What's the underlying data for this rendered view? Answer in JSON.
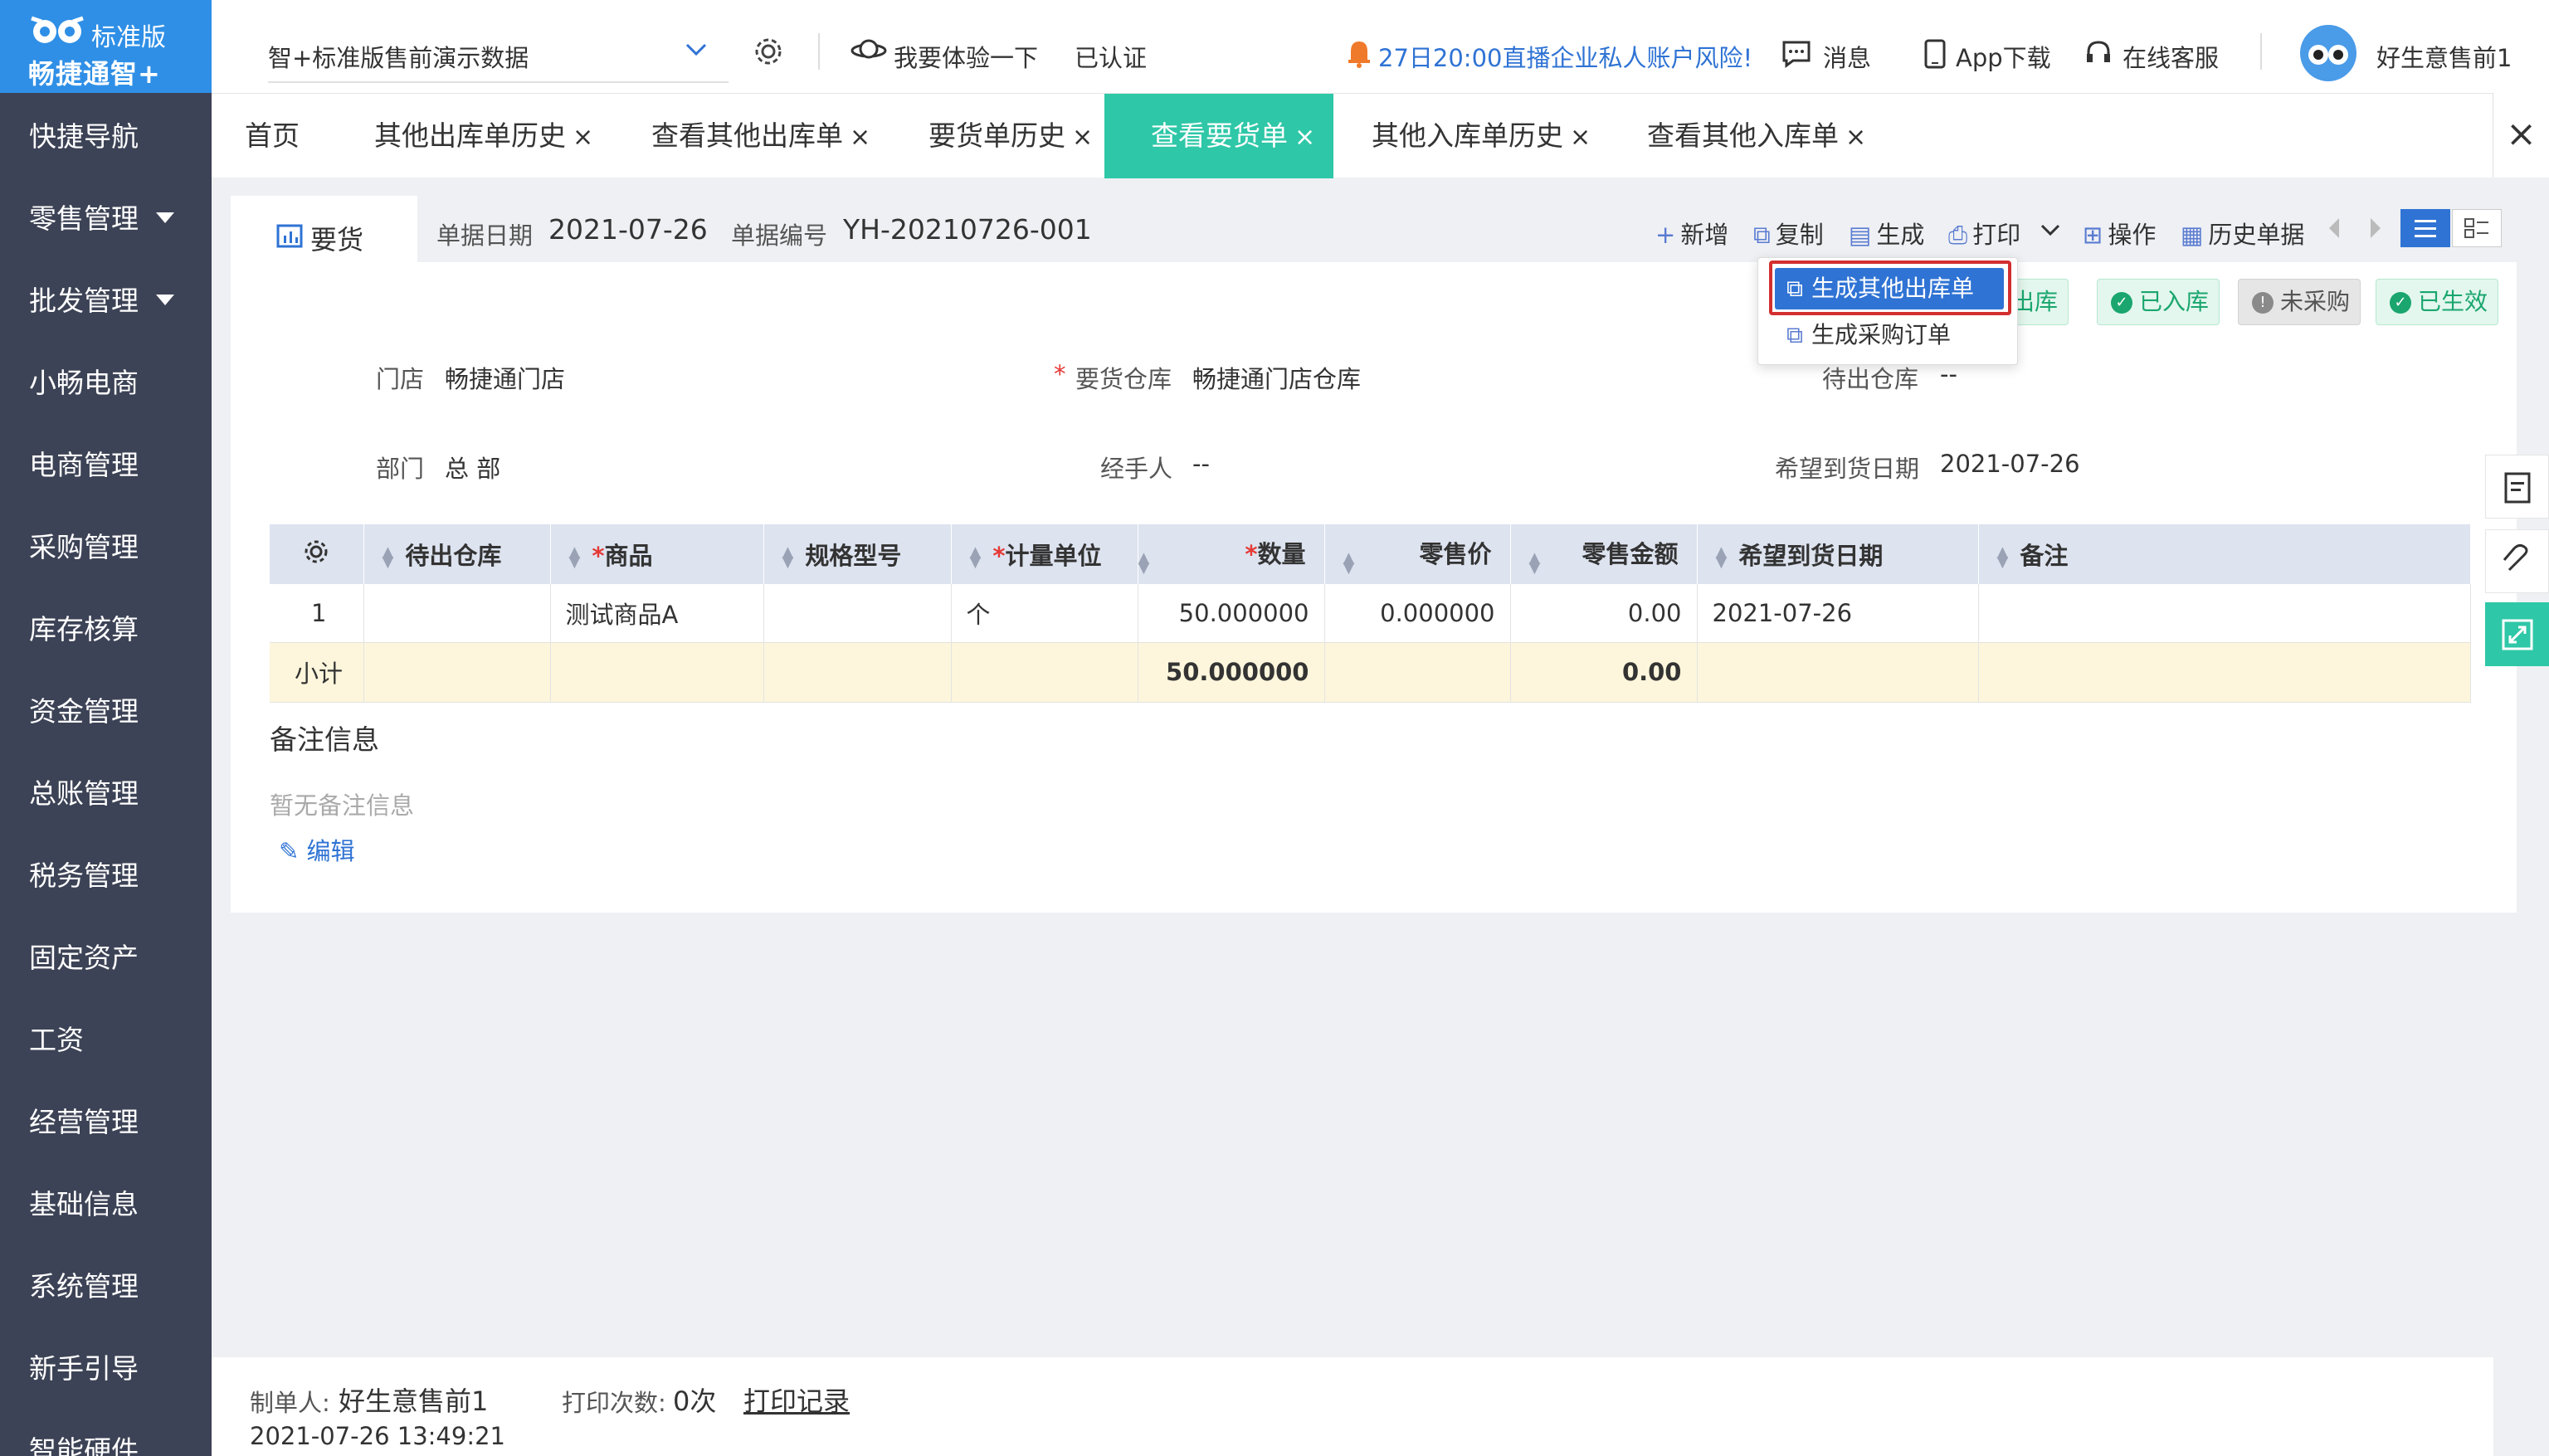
{
  "sidebar": {
    "edition": "标准版",
    "brand": "畅捷通智+",
    "items": [
      {
        "label": "快捷导航",
        "caret": false
      },
      {
        "label": "零售管理",
        "caret": true
      },
      {
        "label": "批发管理",
        "caret": true
      },
      {
        "label": "小畅电商",
        "caret": false
      },
      {
        "label": "电商管理",
        "caret": false
      },
      {
        "label": "采购管理",
        "caret": false
      },
      {
        "label": "库存核算",
        "caret": false
      },
      {
        "label": "资金管理",
        "caret": false
      },
      {
        "label": "总账管理",
        "caret": false
      },
      {
        "label": "税务管理",
        "caret": false
      },
      {
        "label": "固定资产",
        "caret": false
      },
      {
        "label": "工资",
        "caret": false
      },
      {
        "label": "经营管理",
        "caret": false
      },
      {
        "label": "基础信息",
        "caret": false
      },
      {
        "label": "系统管理",
        "caret": false
      },
      {
        "label": "新手引导",
        "caret": false
      },
      {
        "label": "智能硬件",
        "caret": false
      }
    ]
  },
  "topbar": {
    "account": "智+标准版售前演示数据",
    "trial": "我要体验一下",
    "certified": "已认证",
    "notice": "27日20:00直播企业私人账户风险!",
    "messages": "消息",
    "app_download": "App下载",
    "support": "在线客服",
    "username": "好生意售前1"
  },
  "tabs": [
    {
      "label": "首页",
      "closable": false,
      "active": false
    },
    {
      "label": "其他出库单历史",
      "closable": true,
      "active": false
    },
    {
      "label": "查看其他出库单",
      "closable": true,
      "active": false
    },
    {
      "label": "要货单历史",
      "closable": true,
      "active": false
    },
    {
      "label": "查看要货单",
      "closable": true,
      "active": true
    },
    {
      "label": "其他入库单历史",
      "closable": true,
      "active": false
    },
    {
      "label": "查看其他入库单",
      "closable": true,
      "active": false
    }
  ],
  "close_all": "×",
  "doc": {
    "type_label": "要货",
    "date_label": "单据日期",
    "date_value": "2021-07-26",
    "no_label": "单据编号",
    "no_value": "YH-20210726-001"
  },
  "toolbar": {
    "new": "新增",
    "copy": "复制",
    "generate": "生成",
    "print": "打印",
    "operate": "操作",
    "history": "历史单据"
  },
  "dropdown": {
    "item1": "生成其他出库单",
    "item2": "生成采购订单"
  },
  "badges": [
    {
      "text": "出库",
      "style": "green"
    },
    {
      "text": "已入库",
      "style": "green"
    },
    {
      "text": "未采购",
      "style": "gray"
    },
    {
      "text": "已生效",
      "style": "green"
    }
  ],
  "form": {
    "store_label": "门店",
    "store_value": "畅捷通门店",
    "req_wh_label": "要货仓库",
    "req_wh_value": "畅捷通门店仓库",
    "out_wh_label": "待出仓库",
    "out_wh_value": "--",
    "dept_label": "部门",
    "dept_value": "总 部",
    "handler_label": "经手人",
    "handler_value": "--",
    "expect_label": "希望到货日期",
    "expect_value": "2021-07-26"
  },
  "table": {
    "headers": [
      "待出仓库",
      "商品",
      "规格型号",
      "计量单位",
      "数量",
      "零售价",
      "零售金额",
      "希望到货日期",
      "备注"
    ],
    "rows": [
      {
        "no": "1",
        "warehouse": "",
        "product": "测试商品A",
        "spec": "",
        "unit": "个",
        "qty": "50.000000",
        "price": "0.000000",
        "amount": "0.00",
        "date": "2021-07-26",
        "remark": ""
      }
    ],
    "subtotal": {
      "label": "小计",
      "qty": "50.000000",
      "amount": "0.00"
    }
  },
  "remarks": {
    "title": "备注信息",
    "empty": "暂无备注信息",
    "edit": "编辑"
  },
  "footer": {
    "maker_label": "制单人:",
    "maker": "好生意售前1",
    "print_count_label": "打印次数:",
    "print_count": "0次",
    "print_log": "打印记录",
    "created": "2021-07-26 13:49:21"
  },
  "colors": {
    "sidebar": "#3d4356",
    "logo": "#2f8fe6",
    "active_tab": "#2ec7a7",
    "accent_blue": "#2f73d4",
    "highlight_red": "#d32f2f"
  }
}
